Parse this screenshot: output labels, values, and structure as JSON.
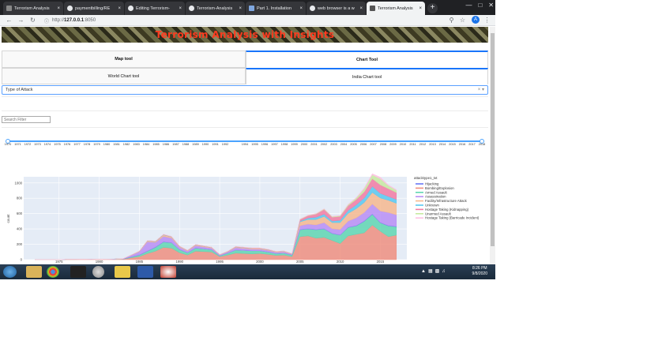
{
  "browser": {
    "tabs": [
      {
        "label": "Terrorism Analysis",
        "icon": "terrorism-favicon-icon",
        "active": false
      },
      {
        "label": "paymentbilling/RE",
        "icon": "github-icon",
        "active": false
      },
      {
        "label": "Editing Terrorism-",
        "icon": "github-icon",
        "active": false
      },
      {
        "label": "Terrorism-Analysis",
        "icon": "github-icon",
        "active": false
      },
      {
        "label": "Part 1. Installation",
        "icon": "document-icon",
        "active": false
      },
      {
        "label": "web browser is a w",
        "icon": "google-icon",
        "active": false
      },
      {
        "label": "Terrorism Analysis",
        "icon": "terrorism-favicon-icon",
        "active": true
      }
    ],
    "new_tab": "+",
    "url_scheme": "http://",
    "url_host": "127.0.0.1",
    "url_port": ":8050",
    "profile_initial": "A"
  },
  "app": {
    "title": "Terrorism Analysis with Insights",
    "main_tabs": [
      {
        "label": "Map tool",
        "selected": false
      },
      {
        "label": "Chart Tool",
        "selected": true
      }
    ],
    "sub_tabs": [
      {
        "label": "World Chart tool",
        "selected": false
      },
      {
        "label": "India Chart tool",
        "selected": true
      }
    ],
    "dropdown": {
      "value": "Type of Attack",
      "clear": "×",
      "arrow": "▾"
    },
    "search": {
      "placeholder": "Search Filter"
    },
    "year_slider": {
      "min": 1970,
      "max": 2018,
      "selected": [
        1970,
        2018
      ],
      "marks": [
        "1970",
        "1971",
        "1972",
        "1973",
        "1974",
        "1975",
        "1976",
        "1977",
        "1978",
        "1979",
        "1980",
        "1981",
        "1982",
        "1983",
        "1984",
        "1985",
        "1986",
        "1987",
        "1988",
        "1989",
        "1990",
        "1991",
        "1992",
        "1994",
        "1995",
        "1996",
        "1997",
        "1998",
        "1999",
        "2000",
        "2001",
        "2002",
        "2003",
        "2004",
        "2005",
        "2006",
        "2007",
        "2008",
        "2009",
        "2010",
        "2011",
        "2012",
        "2013",
        "2014",
        "2015",
        "2016",
        "2017",
        "2018"
      ]
    }
  },
  "chart_data": {
    "type": "area",
    "ylabel": "count",
    "xlabel": "",
    "ylim": [
      0,
      1080
    ],
    "yticks": [
      0,
      200,
      400,
      600,
      800,
      1000
    ],
    "xticks": [
      1975,
      1980,
      1985,
      1990,
      1995,
      2000,
      2005,
      2010,
      2015
    ],
    "legend_title": "attacktype1_txt",
    "legend_position": "right",
    "x": [
      1972,
      1975,
      1976,
      1977,
      1978,
      1979,
      1980,
      1981,
      1982,
      1983,
      1984,
      1985,
      1986,
      1987,
      1988,
      1989,
      1990,
      1991,
      1992,
      1994,
      1995,
      1996,
      1997,
      1998,
      1999,
      2000,
      2001,
      2002,
      2003,
      2004,
      2005,
      2006,
      2007,
      2008,
      2009,
      2010,
      2011,
      2012,
      2013,
      2014,
      2015,
      2016,
      2017
    ],
    "series": [
      {
        "name": "Bombing/Explosion",
        "color": "#ef8f80",
        "values": [
          0,
          0,
          2,
          2,
          3,
          4,
          2,
          3,
          5,
          7,
          25,
          40,
          80,
          110,
          160,
          150,
          90,
          60,
          110,
          100,
          40,
          60,
          85,
          80,
          75,
          80,
          70,
          55,
          60,
          40,
          300,
          310,
          280,
          290,
          250,
          210,
          310,
          330,
          350,
          450,
          370,
          300,
          320
        ]
      },
      {
        "name": "Armed Assault",
        "color": "#5fd6b2",
        "values": [
          0,
          0,
          1,
          1,
          1,
          2,
          2,
          2,
          2,
          3,
          10,
          20,
          30,
          50,
          70,
          70,
          40,
          30,
          40,
          30,
          10,
          25,
          40,
          40,
          40,
          35,
          30,
          25,
          25,
          20,
          90,
          90,
          110,
          110,
          90,
          110,
          110,
          110,
          150,
          140,
          110,
          140,
          110
        ]
      },
      {
        "name": "Hijacking",
        "color": "#6a78f7",
        "values": [
          0,
          0,
          0,
          0,
          0,
          0,
          0,
          0,
          0,
          0,
          2,
          3,
          3,
          4,
          3,
          2,
          2,
          1,
          2,
          1,
          1,
          1,
          1,
          1,
          1,
          1,
          1,
          1,
          1,
          1,
          3,
          3,
          3,
          3,
          3,
          3,
          3,
          4,
          5,
          5,
          4,
          4,
          4
        ]
      },
      {
        "name": "Assassination",
        "color": "#b98ef5",
        "values": [
          0,
          0,
          1,
          1,
          1,
          1,
          1,
          1,
          1,
          2,
          20,
          40,
          120,
          60,
          70,
          60,
          30,
          20,
          30,
          20,
          10,
          15,
          30,
          25,
          20,
          20,
          20,
          15,
          15,
          10,
          50,
          60,
          60,
          80,
          60,
          70,
          80,
          100,
          110,
          130,
          150,
          170,
          150
        ]
      },
      {
        "name": "Facility/Infrastructure Attack",
        "color": "#f6b98f",
        "values": [
          0,
          0,
          0,
          0,
          0,
          0,
          0,
          0,
          0,
          1,
          3,
          5,
          10,
          10,
          20,
          15,
          10,
          8,
          10,
          8,
          5,
          5,
          10,
          10,
          10,
          10,
          8,
          8,
          8,
          5,
          50,
          60,
          70,
          80,
          80,
          90,
          100,
          120,
          130,
          150,
          170,
          160,
          150
        ]
      },
      {
        "name": "Unknown",
        "color": "#59c8f0",
        "values": [
          0,
          0,
          0,
          0,
          0,
          0,
          0,
          0,
          0,
          0,
          1,
          1,
          2,
          3,
          3,
          2,
          2,
          1,
          2,
          1,
          1,
          1,
          2,
          2,
          2,
          2,
          2,
          1,
          1,
          1,
          10,
          20,
          30,
          30,
          20,
          30,
          40,
          50,
          60,
          80,
          60,
          50,
          50
        ]
      },
      {
        "name": "Hostage Taking (Kidnapping)",
        "color": "#f27ba3",
        "values": [
          0,
          0,
          0,
          0,
          0,
          0,
          0,
          0,
          0,
          0,
          1,
          2,
          3,
          3,
          3,
          3,
          2,
          2,
          3,
          2,
          1,
          2,
          3,
          3,
          3,
          3,
          3,
          2,
          2,
          2,
          20,
          30,
          40,
          60,
          50,
          50,
          60,
          70,
          80,
          100,
          110,
          100,
          90
        ]
      },
      {
        "name": "Unarmed Assault",
        "color": "#c7eaa0",
        "values": [
          0,
          0,
          0,
          0,
          0,
          0,
          0,
          0,
          0,
          0,
          0,
          1,
          1,
          1,
          1,
          1,
          1,
          1,
          1,
          1,
          0,
          1,
          1,
          1,
          1,
          1,
          1,
          1,
          1,
          1,
          5,
          5,
          5,
          8,
          8,
          10,
          15,
          20,
          40,
          50,
          80,
          40,
          30
        ]
      },
      {
        "name": "Hostage Taking (Barricade Incident)",
        "color": "#fdc1e2",
        "values": [
          0,
          0,
          0,
          0,
          0,
          0,
          0,
          0,
          0,
          0,
          0,
          0,
          1,
          1,
          1,
          1,
          1,
          0,
          1,
          0,
          0,
          0,
          1,
          1,
          1,
          1,
          1,
          0,
          0,
          0,
          2,
          2,
          3,
          3,
          3,
          3,
          4,
          5,
          10,
          15,
          20,
          10,
          8
        ]
      }
    ]
  },
  "taskbar": {
    "time": "8:26 PM",
    "date": "9/8/2020"
  }
}
